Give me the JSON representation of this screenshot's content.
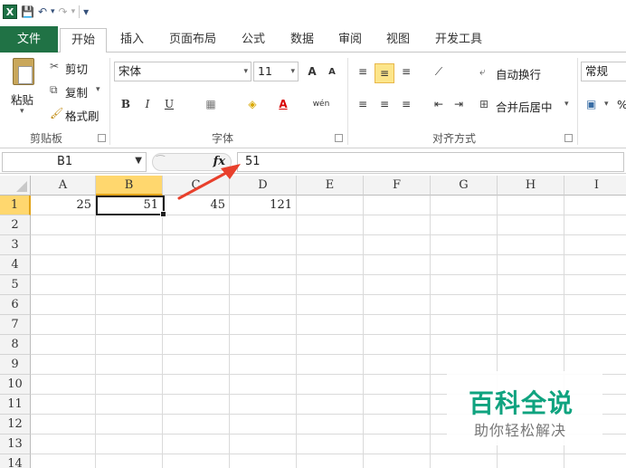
{
  "quick_access": {
    "logo": "X",
    "save": "💾",
    "undo": "↶",
    "redo": "↷",
    "more": "▾"
  },
  "tabs": [
    {
      "label": "文件"
    },
    {
      "label": "开始"
    },
    {
      "label": "插入"
    },
    {
      "label": "页面布局"
    },
    {
      "label": "公式"
    },
    {
      "label": "数据"
    },
    {
      "label": "审阅"
    },
    {
      "label": "视图"
    },
    {
      "label": "开发工具"
    }
  ],
  "ribbon": {
    "clipboard": {
      "paste": "粘贴",
      "cut": "剪切",
      "copy": "复制",
      "format_painter": "格式刷",
      "group": "剪贴板"
    },
    "font": {
      "name": "宋体",
      "size": "11",
      "grow": "A",
      "shrink": "A",
      "bold": "B",
      "italic": "I",
      "underline": "U",
      "phonetic": "wén",
      "group": "字体"
    },
    "alignment": {
      "wrap": "自动换行",
      "merge": "合并后居中",
      "group": "对齐方式"
    },
    "number": {
      "format": "常规",
      "percent": "%"
    }
  },
  "formula_bar": {
    "name_box": "B1",
    "fx": "fx",
    "content": "51"
  },
  "columns": [
    "A",
    "B",
    "C",
    "D",
    "E",
    "F",
    "G",
    "H",
    "I"
  ],
  "rows": [
    "1",
    "2",
    "3",
    "4",
    "5",
    "6",
    "7",
    "8",
    "9",
    "10",
    "11",
    "12",
    "13",
    "14"
  ],
  "cells": {
    "A1": "25",
    "B1": "51",
    "C1": "45",
    "D1": "121"
  },
  "watermark": {
    "title": "百科全说",
    "subtitle": "助你轻松解决"
  },
  "colors": {
    "file_tab": "#207245",
    "selection": "#ffd76e",
    "arrow": "#e8402c",
    "watermark": "#0fa37f"
  }
}
